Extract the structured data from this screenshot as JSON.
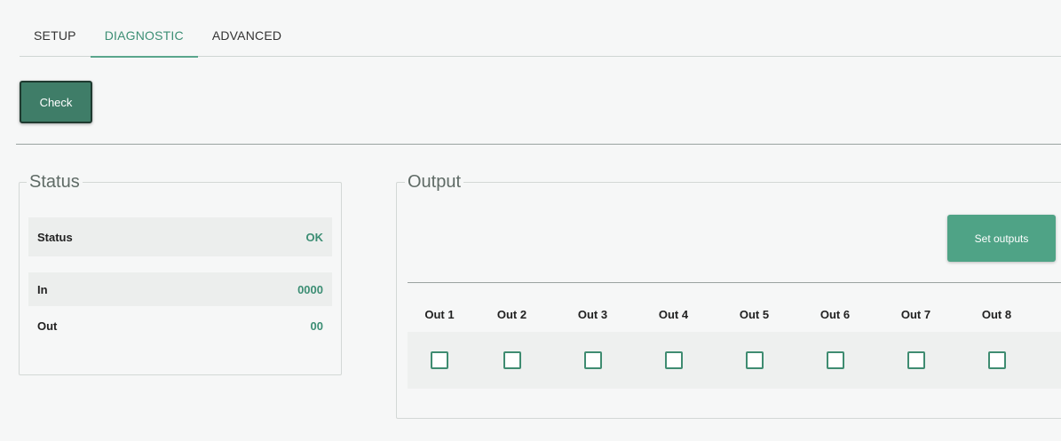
{
  "tabs": [
    {
      "label": "SETUP",
      "active": false
    },
    {
      "label": "DIAGNOSTIC",
      "active": true
    },
    {
      "label": "ADVANCED",
      "active": false
    }
  ],
  "check_button": {
    "label": "Check"
  },
  "status_panel": {
    "title": "Status",
    "rows": [
      {
        "label": "Status",
        "value": "OK"
      },
      {
        "label": "In",
        "value": "0000"
      },
      {
        "label": "Out",
        "value": "00"
      }
    ]
  },
  "output_panel": {
    "title": "Output",
    "set_button": {
      "label": "Set outputs"
    },
    "outputs": [
      {
        "label": "Out 1",
        "checked": false
      },
      {
        "label": "Out 2",
        "checked": false
      },
      {
        "label": "Out 3",
        "checked": false
      },
      {
        "label": "Out 4",
        "checked": false
      },
      {
        "label": "Out 5",
        "checked": false
      },
      {
        "label": "Out 6",
        "checked": false
      },
      {
        "label": "Out 7",
        "checked": false
      },
      {
        "label": "Out 8",
        "checked": false
      }
    ]
  },
  "colors": {
    "accent": "#3c8e74",
    "button_dark": "#3f7d68",
    "button_light": "#4fa386"
  }
}
